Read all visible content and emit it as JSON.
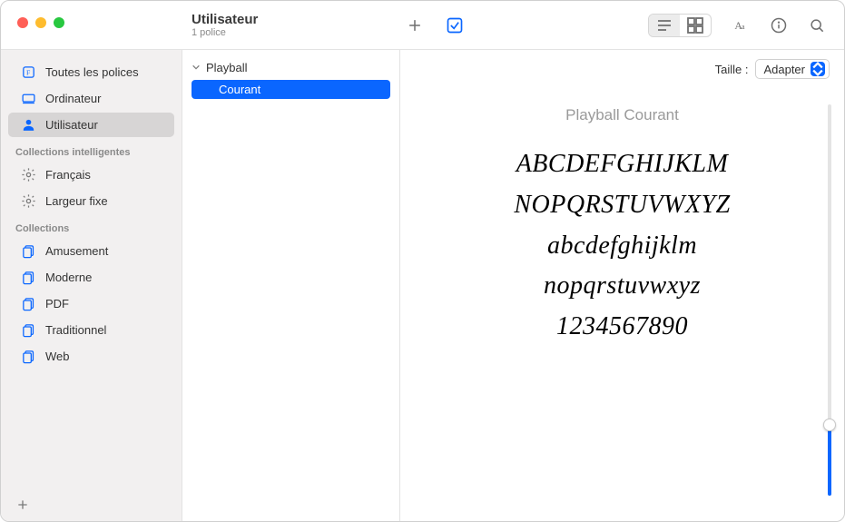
{
  "header": {
    "title": "Utilisateur",
    "subtitle": "1 police"
  },
  "sidebar": {
    "library": [
      {
        "label": "Toutes les polices",
        "icon": "all-fonts-icon"
      },
      {
        "label": "Ordinateur",
        "icon": "computer-icon"
      },
      {
        "label": "Utilisateur",
        "icon": "user-icon",
        "selected": true
      }
    ],
    "smart_header": "Collections intelligentes",
    "smart": [
      {
        "label": "Français",
        "icon": "gear-icon"
      },
      {
        "label": "Largeur fixe",
        "icon": "gear-icon"
      }
    ],
    "collections_header": "Collections",
    "collections": [
      {
        "label": "Amusement"
      },
      {
        "label": "Moderne"
      },
      {
        "label": "PDF"
      },
      {
        "label": "Traditionnel"
      },
      {
        "label": "Web"
      }
    ]
  },
  "font_list": {
    "family": "Playball",
    "styles": [
      {
        "label": "Courant",
        "selected": true
      }
    ]
  },
  "preview": {
    "size_label": "Taille :",
    "size_value": "Adapter",
    "title": "Playball Courant",
    "lines": [
      "ABCDEFGHIJKLM",
      "NOPQRSTUVWXYZ",
      "abcdefghijklm",
      "nopqrstuvwxyz",
      "1234567890"
    ]
  }
}
